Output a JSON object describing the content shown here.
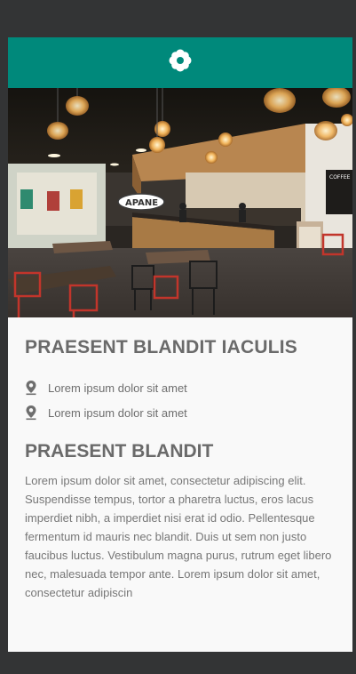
{
  "header": {
    "icon": "flower-icon",
    "color": "#00897b"
  },
  "hero": {
    "sign_text": "APANE",
    "board_text": "COFFEE"
  },
  "section": {
    "title": "PRAESENT BLANDIT IACULIS",
    "locations": [
      {
        "icon": "location-pin-icon",
        "text": "Lorem ipsum dolor sit amet"
      },
      {
        "icon": "location-pin-icon",
        "text": "Lorem ipsum dolor sit amet"
      }
    ],
    "subtitle": "PRAESENT BLANDIT",
    "body": "Lorem ipsum dolor sit amet, consectetur adipiscing elit. Suspendisse tempus, tortor a pharetra luctus, eros lacus imperdiet nibh, a imperdiet nisi erat id odio. Pellentesque fermentum id mauris nec blandit. Duis ut sem non justo faucibus luctus. Vestibulum magna purus, rutrum eget libero nec, malesuada tempor ante. Lorem ipsum dolor sit amet, consectetur adipiscin"
  }
}
